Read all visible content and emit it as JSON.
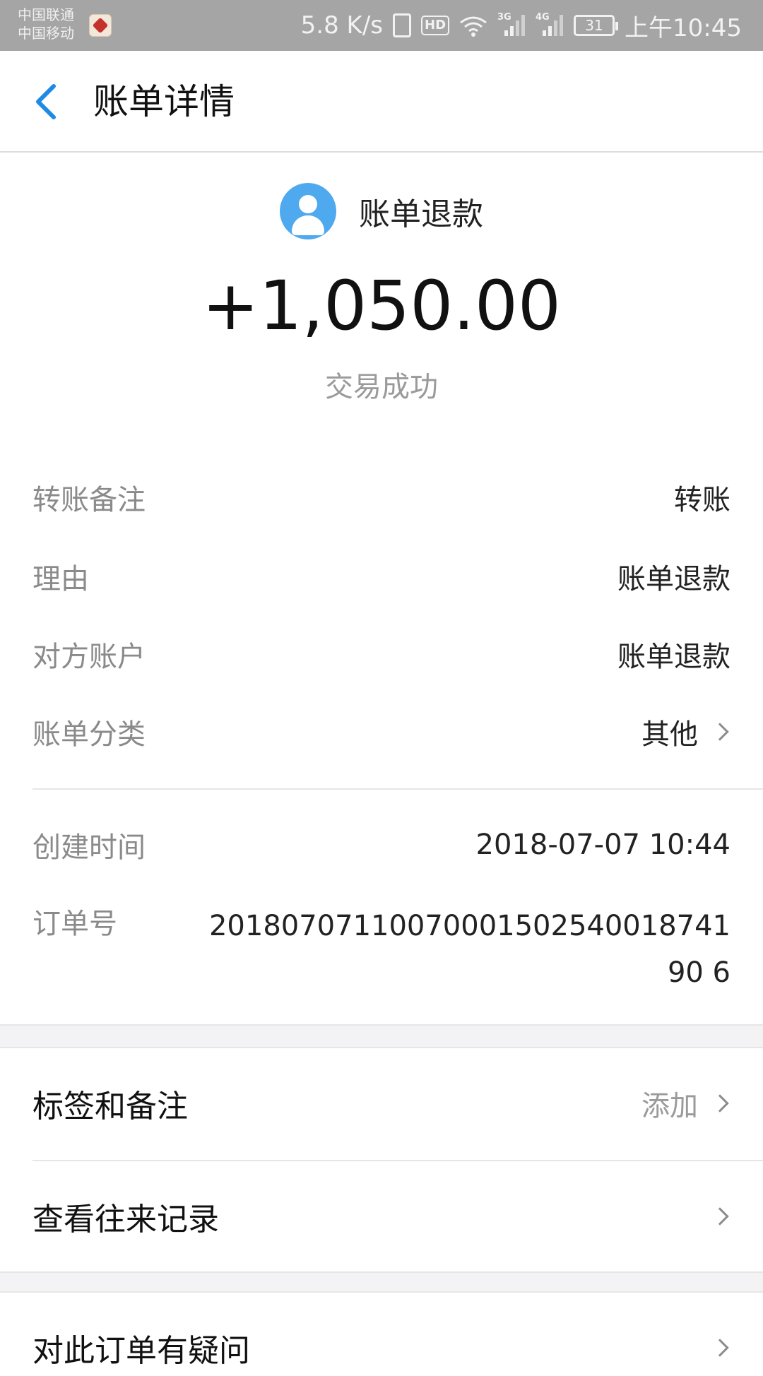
{
  "status_bar": {
    "carrier_1": "中国联通",
    "carrier_2": "中国移动",
    "net_speed": "5.8 K/s",
    "hd": "HD",
    "sim1_type": "3G",
    "sim2_type": "4G",
    "battery": "31",
    "time": "上午10:45"
  },
  "header": {
    "title": "账单详情"
  },
  "summary": {
    "payee": "账单退款",
    "amount": "+1,050.00",
    "status": "交易成功",
    "avatar_color": "#4ea9ee"
  },
  "details": {
    "remark_label": "转账备注",
    "remark_value": "转账",
    "reason_label": "理由",
    "reason_value": "账单退款",
    "counterparty_label": "对方账户",
    "counterparty_value": "账单退款",
    "category_label": "账单分类",
    "category_value": "其他",
    "created_label": "创建时间",
    "created_value": "2018-07-07 10:44",
    "order_label": "订单号",
    "order_value": "2018070711007000150254001874190 6"
  },
  "actions": {
    "tags_label": "标签和备注",
    "tags_hint": "添加",
    "history_label": "查看往来记录",
    "question_label": "对此订单有疑问"
  },
  "colors": {
    "accent": "#1e8ae8",
    "status_bar": "#a5a5a5"
  }
}
